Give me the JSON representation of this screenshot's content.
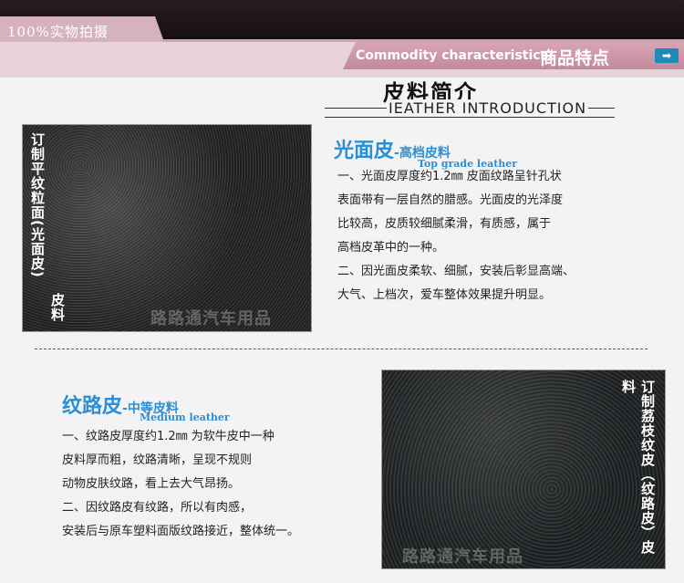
{
  "header": {
    "tab_label": "100%实物拍摄",
    "char_en": "Commodity characteristics/",
    "char_cn": "商品特点",
    "arrow_glyph": "➡"
  },
  "intro": {
    "title_cn": "皮料简介",
    "title_en": "IEATHER INTRODUCTION"
  },
  "smooth": {
    "label_top": "订制平纹粒面(光面皮)",
    "label_bottom": "皮料",
    "watermark": "路路通汽车用品",
    "title_main": "光面皮",
    "title_sub": "-高档皮料",
    "title_en": "Top grade leather",
    "lines": [
      "一、光面皮厚度约1.2㎜ 皮面纹路呈针孔状",
      "表面带有一层自然的腊感。光面皮的光泽度",
      "比较高，皮质较细腻柔滑，有质感，属于",
      "高档皮革中的一种。",
      "二、因光面皮柔软、细腻，安装后彰显高端、",
      "大气、上档次，爱车整体效果提升明显。"
    ]
  },
  "textured": {
    "label": "订制荔枝纹皮（纹路皮）皮料",
    "watermark": "路路通汽车用品",
    "title_main": "纹路皮",
    "title_sub": "-中等皮料",
    "title_en": "Medium leather",
    "lines": [
      "一、纹路皮厚度约1.2㎜ 为软牛皮中一种",
      "皮料厚而粗，纹路清晰，呈现不规则",
      "动物皮肤纹路，看上去大气昂扬。",
      "二、因纹路皮有纹路，所以有肉感，",
      "安装后与原车塑料面版纹路接近，整体统一。"
    ]
  }
}
